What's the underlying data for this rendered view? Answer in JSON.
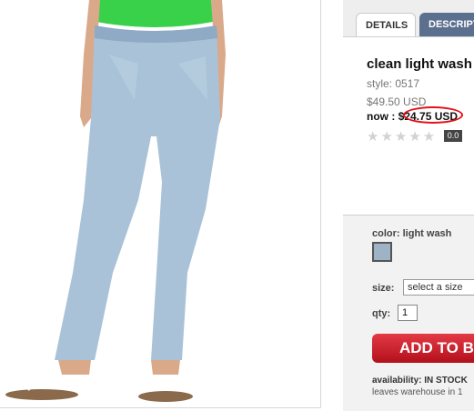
{
  "product": {
    "image_alt": "model wearing clean light wash skinny jeans",
    "title": "clean light wash",
    "style": "style: 0517",
    "original_price": "$49.50 USD",
    "now_label": "now : $24.75 USD",
    "rating": "0.0",
    "stars": "★★★★★"
  },
  "tabs": [
    {
      "label": "DETAILS"
    },
    {
      "label": "DESCRIPT"
    }
  ],
  "options": {
    "color_label": "color: light wash",
    "swatch_color": "#9fb3c6",
    "size_label": "size:",
    "size_value": "select a size",
    "qty_label": "qty:",
    "qty_value": "1",
    "add_button": "ADD TO BA",
    "availability": "availability: IN STOCK",
    "ship_note": "leaves warehouse in 1"
  },
  "colors": {
    "sale_highlight": "#e3131b",
    "tab_active_bg": "#5b6f8e",
    "add_button": "#c8202c"
  }
}
